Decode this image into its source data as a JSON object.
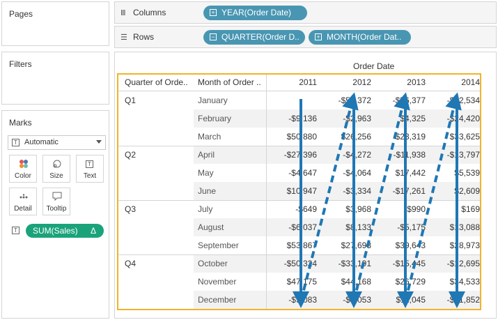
{
  "left_panel": {
    "pages_title": "Pages",
    "filters_title": "Filters",
    "marks_title": "Marks",
    "mark_type": "Automatic",
    "buttons": [
      {
        "label": "Color",
        "icon": "color-dots-icon"
      },
      {
        "label": "Size",
        "icon": "size-icon"
      },
      {
        "label": "Text",
        "icon": "text-icon"
      },
      {
        "label": "Detail",
        "icon": "detail-icon"
      },
      {
        "label": "Tooltip",
        "icon": "tooltip-icon"
      }
    ],
    "text_glyph": "T",
    "measure_pill": "SUM(Sales)",
    "measure_pill_suffix": "Δ"
  },
  "shelves": {
    "columns_label": "Columns",
    "rows_label": "Rows",
    "columns_pill": "YEAR(Order Date)",
    "rows_pills": [
      "QUARTER(Order D..",
      "MONTH(Order Dat.."
    ],
    "pill_color": "#4996b2"
  },
  "table": {
    "column_group_header": "Order Date",
    "row_headers": [
      "Quarter of Orde..",
      "Month of Order .."
    ],
    "years": [
      "2011",
      "2012",
      "2013",
      "2014"
    ],
    "quarters": [
      "Q1",
      "Q2",
      "Q3",
      "Q4"
    ],
    "months": [
      "January",
      "February",
      "March",
      "April",
      "May",
      "June",
      "July",
      "August",
      "September",
      "October",
      "November",
      "December"
    ],
    "values": [
      [
        "",
        "-$51,372",
        "-$56,377",
        "-$52,534"
      ],
      [
        "-$9,136",
        "-$2,963",
        "$4,325",
        "-$24,420"
      ],
      [
        "$50,880",
        "$26,256",
        "$23,319",
        "$33,625"
      ],
      [
        "-$27,396",
        "-$4,272",
        "-$11,938",
        "-$13,797"
      ],
      [
        "-$4,647",
        "-$4,064",
        "$17,442",
        "$5,539"
      ],
      [
        "$10,947",
        "-$3,334",
        "-$17,261",
        "$2,609"
      ],
      [
        "-$649",
        "$3,968",
        "$990",
        "$169"
      ],
      [
        "-$6,037",
        "$8,133",
        "-$5,175",
        "$13,088"
      ],
      [
        "$53,867",
        "$27,698",
        "$39,643",
        "$28,973"
      ],
      [
        "-$50,324",
        "-$33,191",
        "-$15,445",
        "-$12,695"
      ],
      [
        "$47,175",
        "$44,168",
        "$26,729",
        "$34,533"
      ],
      [
        "-$9,083",
        "-$1,053",
        "$11,045",
        "-$21,852"
      ]
    ]
  },
  "colors": {
    "highlight_border": "#f0b429",
    "arrow": "#1f77b4",
    "pill_green": "#1aa37a"
  }
}
